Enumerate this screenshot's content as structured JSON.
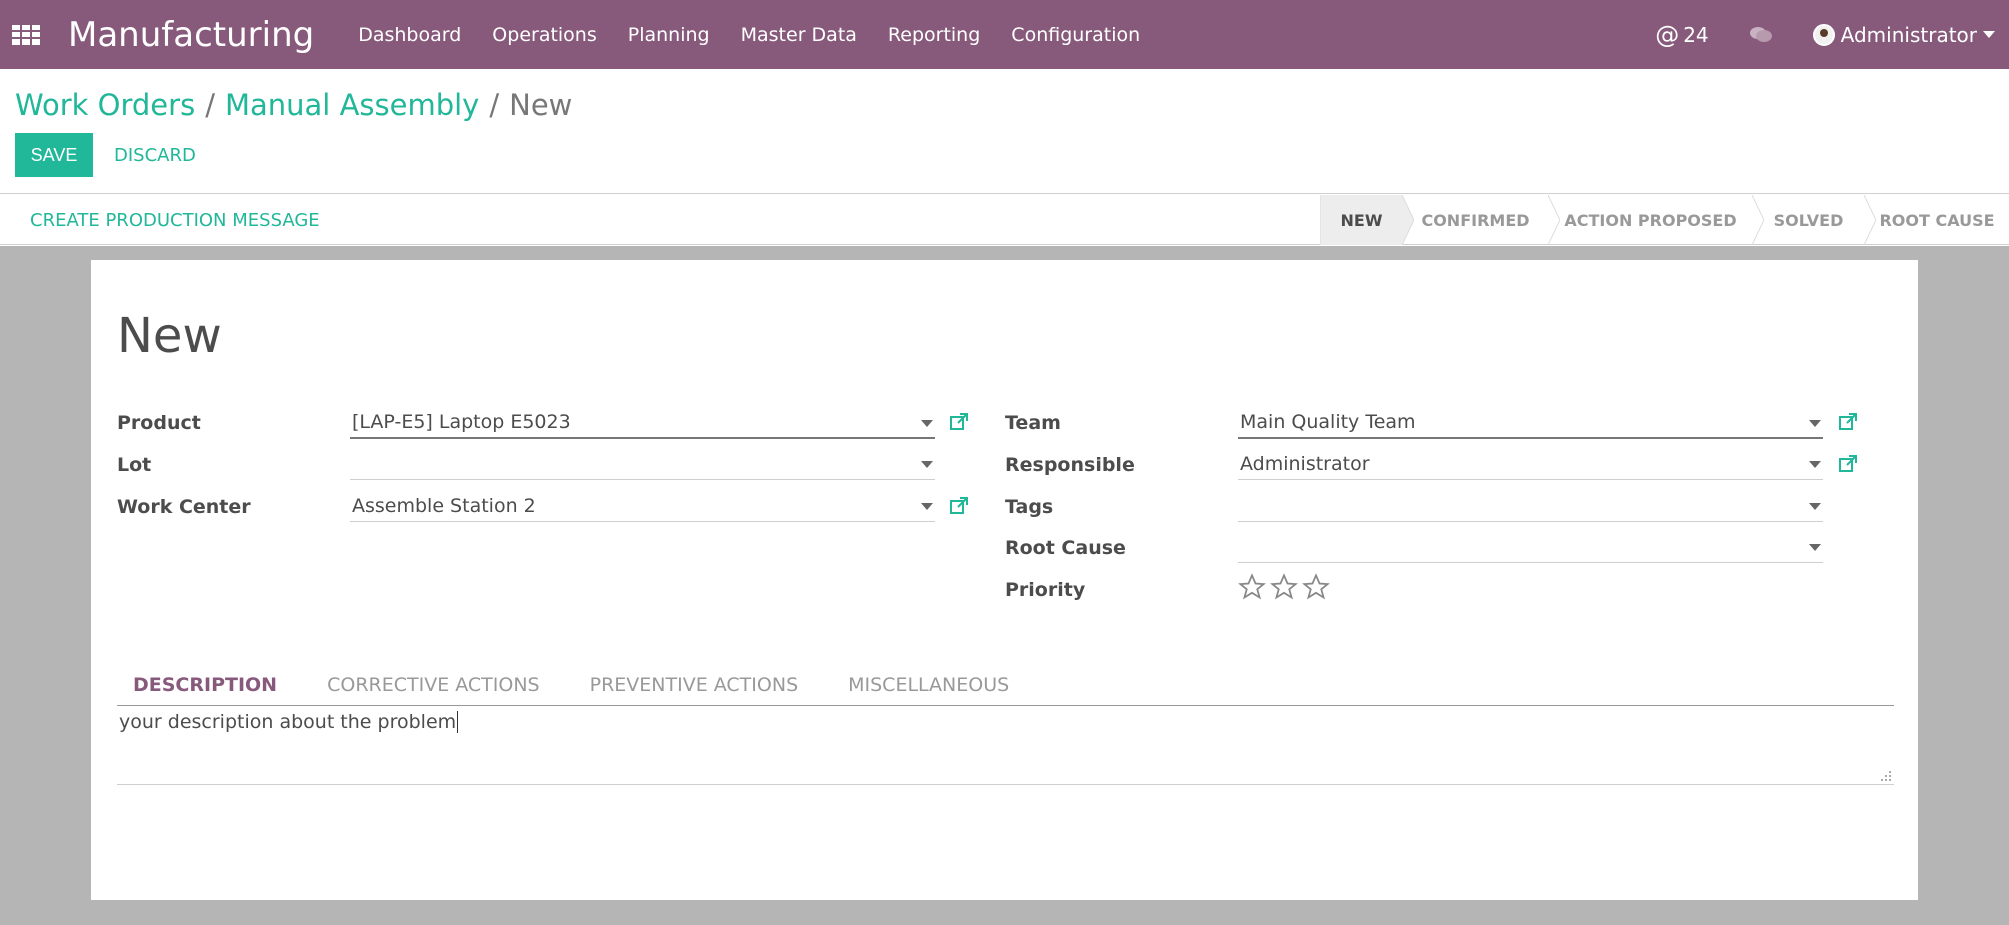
{
  "app": {
    "title": "Manufacturing"
  },
  "menu": [
    "Dashboard",
    "Operations",
    "Planning",
    "Master Data",
    "Reporting",
    "Configuration"
  ],
  "systray": {
    "mention_count": "24",
    "user": "Administrator"
  },
  "breadcrumb": {
    "level1": "Work Orders",
    "level2": "Manual Assembly",
    "current": "New"
  },
  "buttons": {
    "save": "SAVE",
    "discard": "DISCARD",
    "create_message": "CREATE PRODUCTION MESSAGE"
  },
  "stages": [
    "NEW",
    "CONFIRMED",
    "ACTION PROPOSED",
    "SOLVED",
    "ROOT CAUSE"
  ],
  "active_stage": "NEW",
  "form": {
    "title": "New",
    "product": {
      "label": "Product",
      "value": "[LAP-E5] Laptop E5023"
    },
    "lot": {
      "label": "Lot",
      "value": ""
    },
    "work_center": {
      "label": "Work Center",
      "value": "Assemble Station 2"
    },
    "team": {
      "label": "Team",
      "value": "Main Quality Team"
    },
    "responsible": {
      "label": "Responsible",
      "value": "Administrator"
    },
    "tags": {
      "label": "Tags",
      "value": ""
    },
    "root_cause": {
      "label": "Root Cause",
      "value": ""
    },
    "priority": {
      "label": "Priority",
      "stars": 3,
      "selected": 0
    }
  },
  "tabs": [
    "DESCRIPTION",
    "CORRECTIVE ACTIONS",
    "PREVENTIVE ACTIONS",
    "MISCELLANEOUS"
  ],
  "active_tab": "DESCRIPTION",
  "description_text": "your description about the problem",
  "colors": {
    "brand": "#875a7b",
    "accent": "#21b799"
  }
}
